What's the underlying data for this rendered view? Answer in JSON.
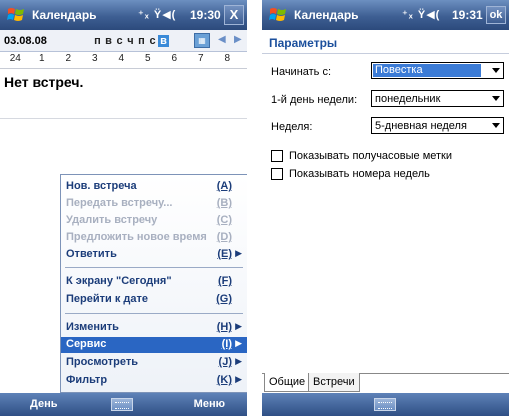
{
  "left": {
    "title": "Календарь",
    "status_icons": "⁺ₓ Ÿ◀(",
    "clock": "19:30",
    "close_label": "X",
    "date": "03.08.08",
    "weekdays": [
      "п",
      "в",
      "с",
      "ч",
      "п",
      "с",
      "в"
    ],
    "selected_weekday_index": 6,
    "today_label": "▦",
    "prev_label": "◀",
    "next_label": "▶",
    "day_numbers": [
      "24",
      "1",
      "2",
      "3",
      "4",
      "5",
      "6",
      "7",
      "8",
      "9"
    ],
    "no_events": "Нет встреч.",
    "menu": [
      {
        "label": "Нов. встреча",
        "key": "(A)",
        "disabled": false,
        "submenu": false
      },
      {
        "label": "Передать встречу...",
        "key": "(B)",
        "disabled": true,
        "submenu": false
      },
      {
        "label": "Удалить встречу",
        "key": "(C)",
        "disabled": true,
        "submenu": false
      },
      {
        "label": "Предложить новое время",
        "key": "(D)",
        "disabled": true,
        "submenu": false
      },
      {
        "label": "Ответить",
        "key": "(E)",
        "disabled": false,
        "submenu": true
      },
      {
        "label": "К экрану \"Сегодня\"",
        "key": "(F)",
        "disabled": false,
        "submenu": false
      },
      {
        "label": "Перейти к дате",
        "key": "(G)",
        "disabled": false,
        "submenu": false
      },
      {
        "label": "Изменить",
        "key": "(H)",
        "disabled": false,
        "submenu": true
      },
      {
        "label": "Сервис",
        "key": "(I)",
        "disabled": false,
        "submenu": true,
        "selected": true
      },
      {
        "label": "Просмотреть",
        "key": "(J)",
        "disabled": false,
        "submenu": true
      },
      {
        "label": "Фильтр",
        "key": "(K)",
        "disabled": false,
        "submenu": true
      }
    ],
    "softkey_left": "День",
    "softkey_right": "Меню"
  },
  "right": {
    "title": "Календарь",
    "status_icons": "⁺ₓ Ÿ◀(",
    "clock": "19:31",
    "ok_label": "ok",
    "heading": "Параметры",
    "fields": {
      "start_label": "Начинать с:",
      "start_value": "Повестка",
      "first_day_label": "1-й день недели:",
      "first_day_value": "понедельник",
      "week_label": "Неделя:",
      "week_value": "5-дневная неделя"
    },
    "checkboxes": {
      "half_hour_label": "Показывать получасовые метки",
      "week_numbers_label": "Показывать номера недель"
    },
    "tabs": [
      "Общие",
      "Встречи"
    ]
  },
  "colors": {
    "titlebar": "#3e5f93",
    "accent": "#2a66c3",
    "heading": "#1b4f9c"
  }
}
